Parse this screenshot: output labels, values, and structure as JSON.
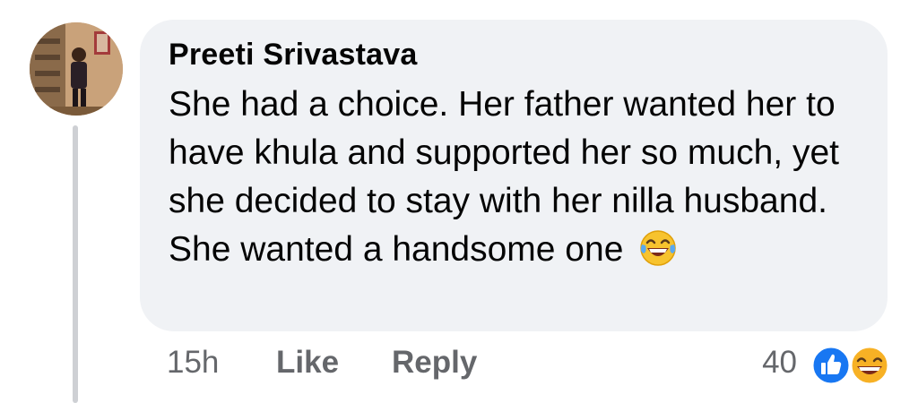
{
  "comment": {
    "author": "Preeti Srivastava",
    "text": "She had a choice. Her father wanted her to have khula and supported her so much, yet she decided to stay with her nilla husband. She wanted a handsome one",
    "emoji": "laughing-tears-emoji"
  },
  "meta": {
    "time": "15h",
    "like_label": "Like",
    "reply_label": "Reply"
  },
  "reactions": {
    "count": "40",
    "icons": [
      "like-icon",
      "haha-icon"
    ],
    "colors": {
      "like": "#1877f2",
      "haha": "#f7b125"
    }
  }
}
